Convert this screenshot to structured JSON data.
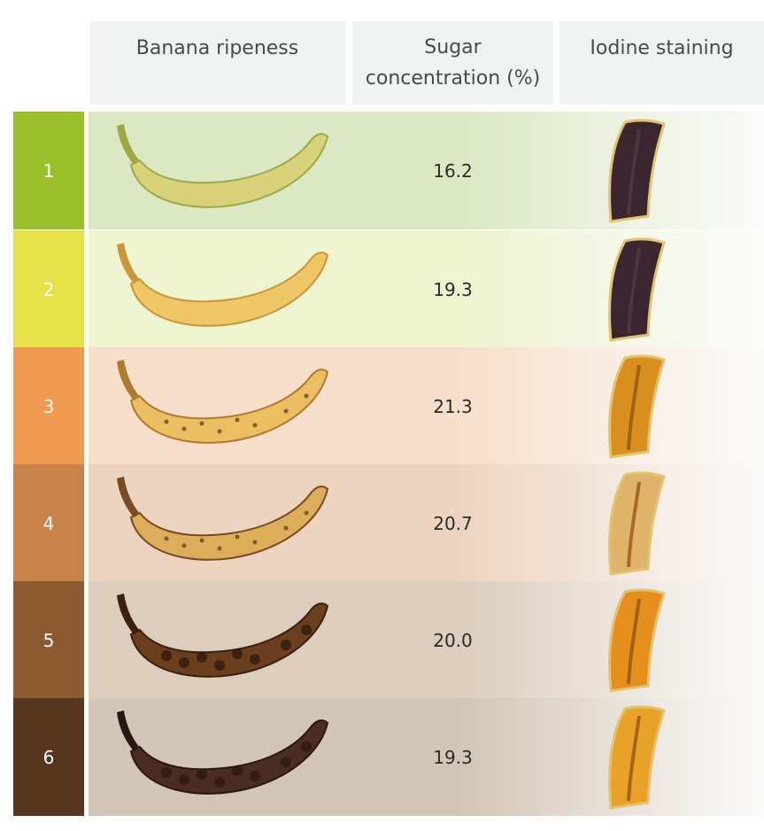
{
  "headers": {
    "ripeness": "Banana ripeness",
    "sugar_line1": "Sugar",
    "sugar_line2": "concentration (%)",
    "iodine": "Iodine staining"
  },
  "rows": [
    {
      "stage": "1",
      "sugar": "16.2",
      "stage_color": "#9bbf2a",
      "band_color": "#dce8c4",
      "peel": "#d9d27a",
      "peel_edge": "#9ea844",
      "slice": "#3b2630"
    },
    {
      "stage": "2",
      "sugar": "19.3",
      "stage_color": "#e5e24a",
      "band_color": "#eef3d0",
      "peel": "#efc766",
      "peel_edge": "#c9973a",
      "slice": "#3a2530"
    },
    {
      "stage": "3",
      "sugar": "21.3",
      "stage_color": "#f09a52",
      "band_color": "#f7dfcb",
      "peel": "#ebbe62",
      "peel_edge": "#b07a2e",
      "slice": "#d98f1e"
    },
    {
      "stage": "4",
      "sugar": "20.7",
      "stage_color": "#c8824a",
      "band_color": "#ecd4c0",
      "peel": "#dcae5a",
      "peel_edge": "#7a4a22",
      "slice": "#e0b36a"
    },
    {
      "stage": "5",
      "sugar": "20.0",
      "stage_color": "#8c5a30",
      "band_color": "#ddcdbd",
      "peel": "#6b3e1e",
      "peel_edge": "#3a2010",
      "slice": "#e5901c"
    },
    {
      "stage": "6",
      "sugar": "19.3",
      "stage_color": "#56361e",
      "band_color": "#d4c6b6",
      "peel": "#4a2c20",
      "peel_edge": "#2a1810",
      "slice": "#e8a22a"
    }
  ]
}
